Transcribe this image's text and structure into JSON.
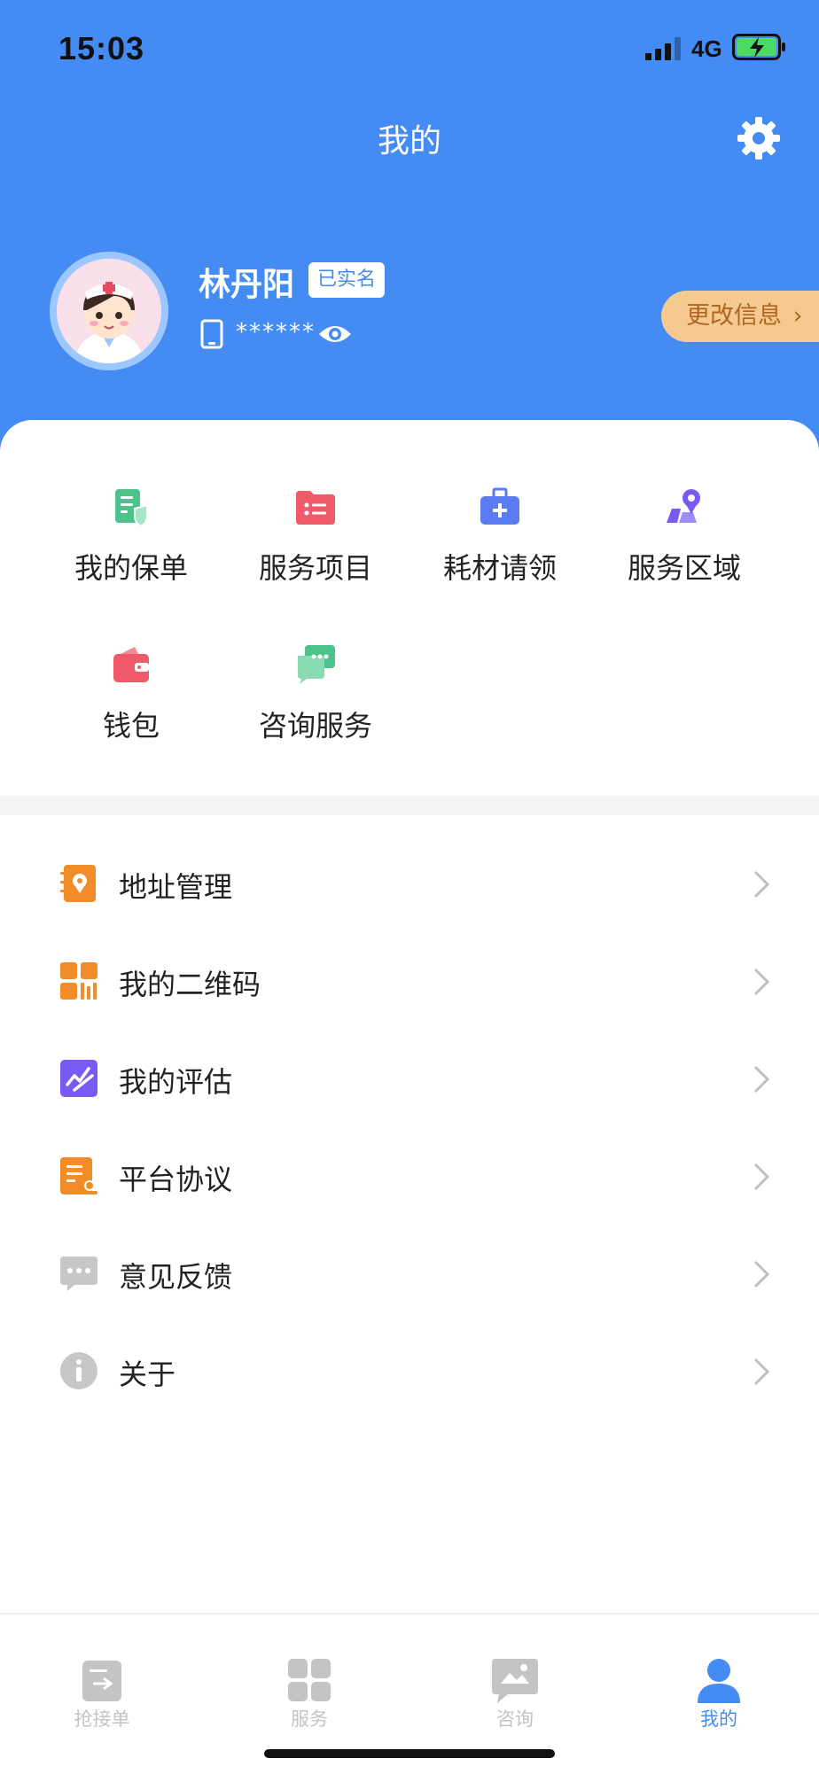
{
  "status": {
    "time": "15:03",
    "network": "4G"
  },
  "nav": {
    "title": "我的"
  },
  "profile": {
    "name": "林丹阳",
    "verified_badge": "已实名",
    "phone_masked": "******",
    "edit_button": "更改信息"
  },
  "grid": [
    {
      "label": "我的保单",
      "icon": "policy-icon",
      "color": "#4cc38a"
    },
    {
      "label": "服务项目",
      "icon": "service-items-icon",
      "color": "#ef5a6a"
    },
    {
      "label": "耗材请领",
      "icon": "supplies-kit-icon",
      "color": "#5a7cf0"
    },
    {
      "label": "服务区域",
      "icon": "service-area-icon",
      "color": "#7a5af5"
    },
    {
      "label": "钱包",
      "icon": "wallet-icon",
      "color": "#ef5a6a"
    },
    {
      "label": "咨询服务",
      "icon": "consult-chat-icon",
      "color": "#4cc38a"
    }
  ],
  "menu": [
    {
      "label": "地址管理",
      "icon": "address-book-icon",
      "color": "#f28c28"
    },
    {
      "label": "我的二维码",
      "icon": "qrcode-icon",
      "color": "#f28c28"
    },
    {
      "label": "我的评估",
      "icon": "assessment-icon",
      "color": "#7a5af5"
    },
    {
      "label": "平台协议",
      "icon": "agreement-icon",
      "color": "#f28c28"
    },
    {
      "label": "意见反馈",
      "icon": "feedback-icon",
      "color": "#c7c7c7"
    },
    {
      "label": "关于",
      "icon": "info-icon",
      "color": "#c7c7c7"
    }
  ],
  "tabs": [
    {
      "label": "抢接单",
      "icon": "grab-order-icon"
    },
    {
      "label": "服务",
      "icon": "service-grid-icon"
    },
    {
      "label": "咨询",
      "icon": "consult-icon"
    },
    {
      "label": "我的",
      "icon": "profile-icon",
      "active": true
    }
  ],
  "colors": {
    "primary": "#448cf4",
    "accent_button": "#f5c98f"
  }
}
